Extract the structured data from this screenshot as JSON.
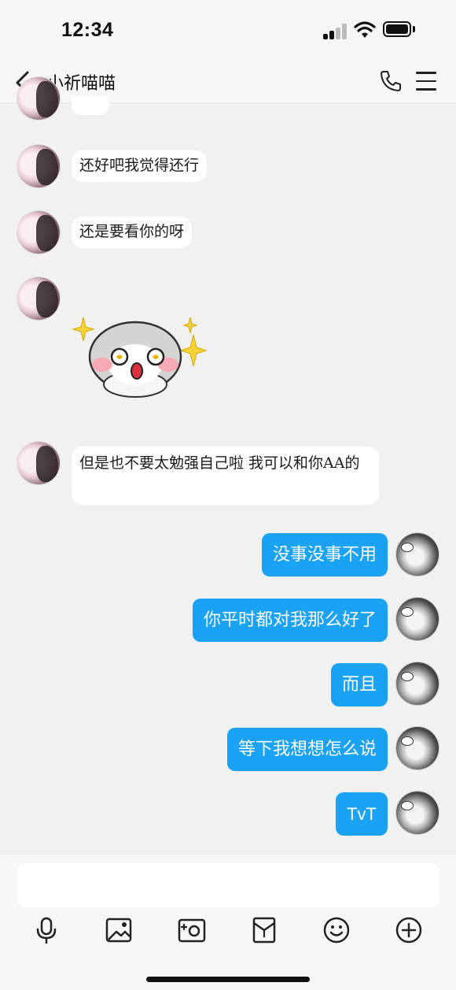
{
  "status_bar": {
    "time": "12:34"
  },
  "header": {
    "contact_name": "小祈喵喵"
  },
  "messages_in": [
    {
      "text": "还好吧我觉得还行"
    },
    {
      "text": "还是要看你的呀"
    },
    {
      "text": "但是也不要太勉强自己啦 我可以和你AA的"
    }
  ],
  "messages_out": [
    {
      "text": "没事没事不用"
    },
    {
      "text": "你平时都对我那么好了"
    },
    {
      "text": "而且"
    },
    {
      "text": "等下我想想怎么说"
    },
    {
      "text": "TvT"
    }
  ],
  "colors": {
    "out_bubble": "#1aa2f5",
    "in_bubble": "#ffffff",
    "background": "#f1f1f1"
  },
  "toolbar": {
    "icons": [
      "microphone-icon",
      "image-icon",
      "camera-icon",
      "red-packet-icon",
      "emoji-icon",
      "plus-icon"
    ]
  }
}
